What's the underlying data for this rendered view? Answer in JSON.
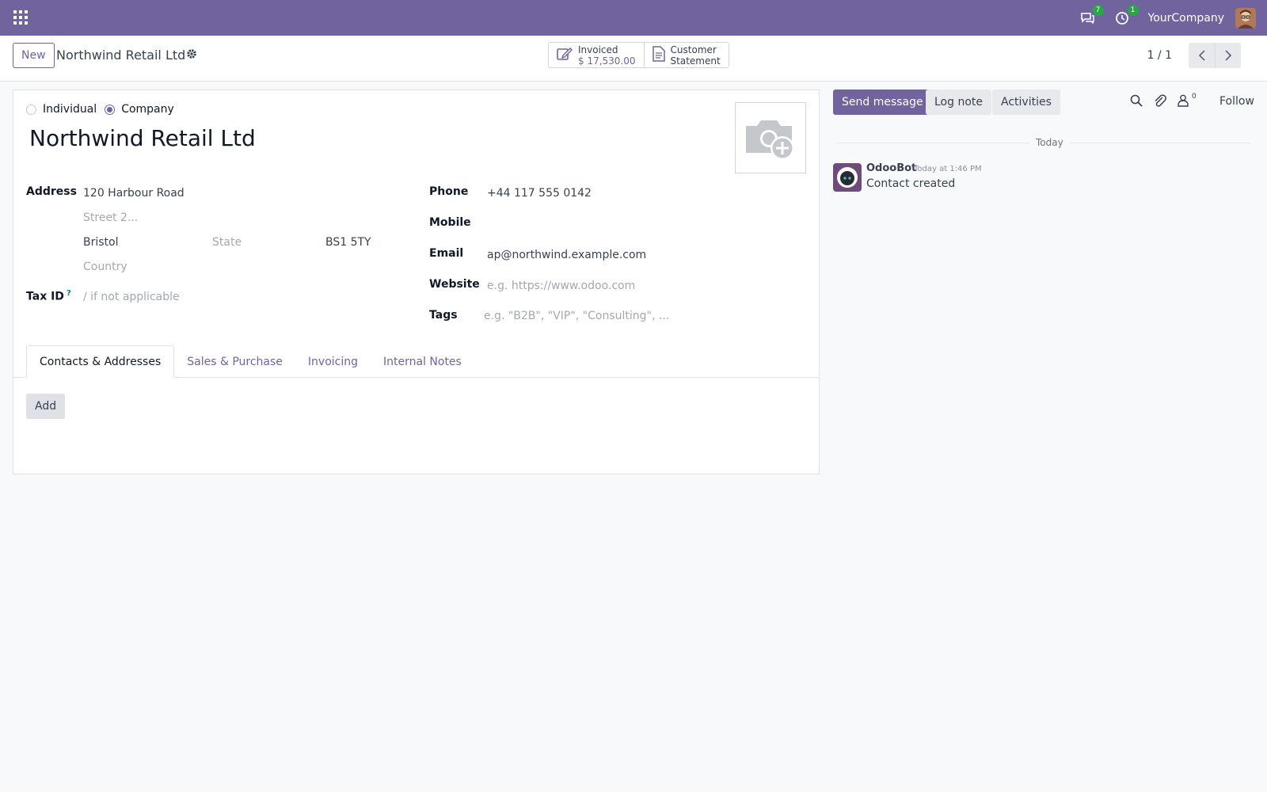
{
  "navbar": {
    "messages_badge": "7",
    "activities_badge": "1",
    "company": "YourCompany",
    "bg_color": "#71639e"
  },
  "control": {
    "new_label": "New",
    "breadcrumb_title": "Northwind Retail Ltd",
    "stat_invoiced_label": "Invoiced",
    "stat_invoiced_value": "$ 17,530.00",
    "stat_statement_line1": "Customer",
    "stat_statement_line2": "Statement",
    "pager": "1 / 1"
  },
  "form": {
    "type_individual": "Individual",
    "type_company": "Company",
    "selected_type": "Company",
    "name": "Northwind Retail Ltd",
    "address_label": "Address",
    "street": "120 Harbour Road",
    "street2_placeholder": "Street 2...",
    "city": "Bristol",
    "state_placeholder": "State",
    "zip": "BS1 5TY",
    "country_placeholder": "Country",
    "tax_id_label": "Tax ID",
    "tax_id_help": "?",
    "tax_id_placeholder": "/ if not applicable",
    "phone_label": "Phone",
    "phone": "+44 117 555 0142",
    "mobile_label": "Mobile",
    "mobile": "",
    "email_label": "Email",
    "email": "ap@northwind.example.com",
    "website_label": "Website",
    "website_placeholder": "e.g. https://www.odoo.com",
    "tags_label": "Tags",
    "tags_placeholder": "e.g. \"B2B\", \"VIP\", \"Consulting\", ..."
  },
  "tabs": [
    {
      "label": "Contacts & Addresses",
      "active": true
    },
    {
      "label": "Sales & Purchase",
      "active": false
    },
    {
      "label": "Invoicing",
      "active": false
    },
    {
      "label": "Internal Notes",
      "active": false
    }
  ],
  "add_label": "Add",
  "chatter": {
    "send_message": "Send message",
    "log_note": "Log note",
    "activities": "Activities",
    "followers_count": "0",
    "follow": "Follow",
    "day_separator": "Today",
    "messages": [
      {
        "author": "OdooBot",
        "date": "Today at 1:46 PM",
        "body": "Contact created"
      }
    ]
  }
}
